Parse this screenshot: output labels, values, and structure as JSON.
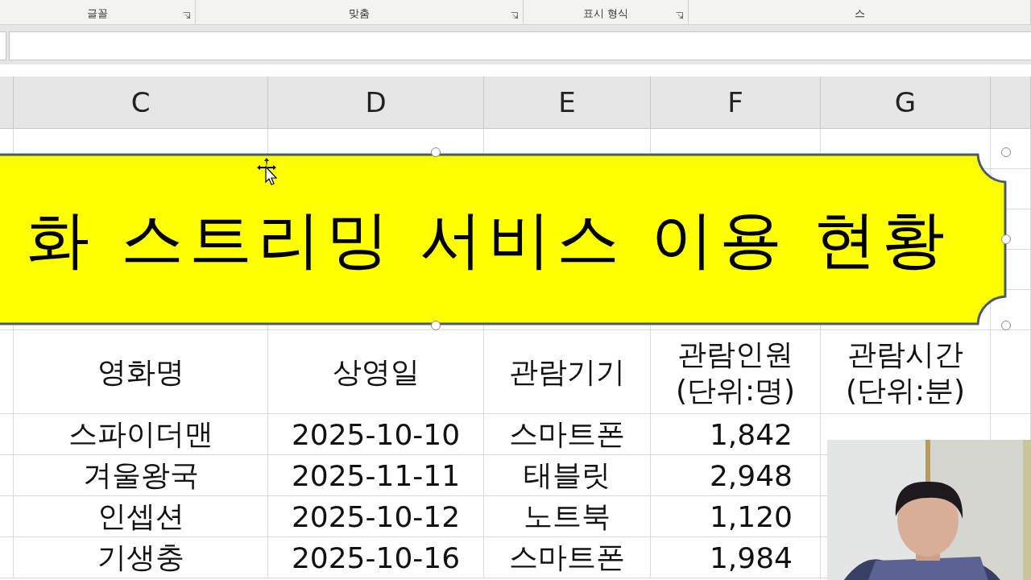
{
  "ribbon": {
    "groups": [
      {
        "label": "글꼴",
        "kind": "group"
      },
      {
        "label": "맞춤",
        "kind": "group"
      },
      {
        "label": "표시 형식",
        "kind": "group"
      },
      {
        "label": "스",
        "kind": "cut"
      }
    ]
  },
  "column_headers": [
    "C",
    "D",
    "E",
    "F",
    "G"
  ],
  "banner": {
    "text": "화 스트리밍 서비스 이용 현황"
  },
  "table": {
    "columns": [
      "영화명",
      "상영일",
      "관람기기",
      "관람인원\n(단위:명)",
      "관람시간\n(단위:분)"
    ],
    "rows": [
      [
        "스파이더맨",
        "2025-10-10",
        "스마트폰",
        "1,842"
      ],
      [
        "겨울왕국",
        "2025-11-11",
        "태블릿",
        "2,948"
      ],
      [
        "인셉션",
        "2025-10-12",
        "노트북",
        "1,120"
      ],
      [
        "기생충",
        "2025-10-16",
        "스마트폰",
        "1,984"
      ]
    ]
  }
}
